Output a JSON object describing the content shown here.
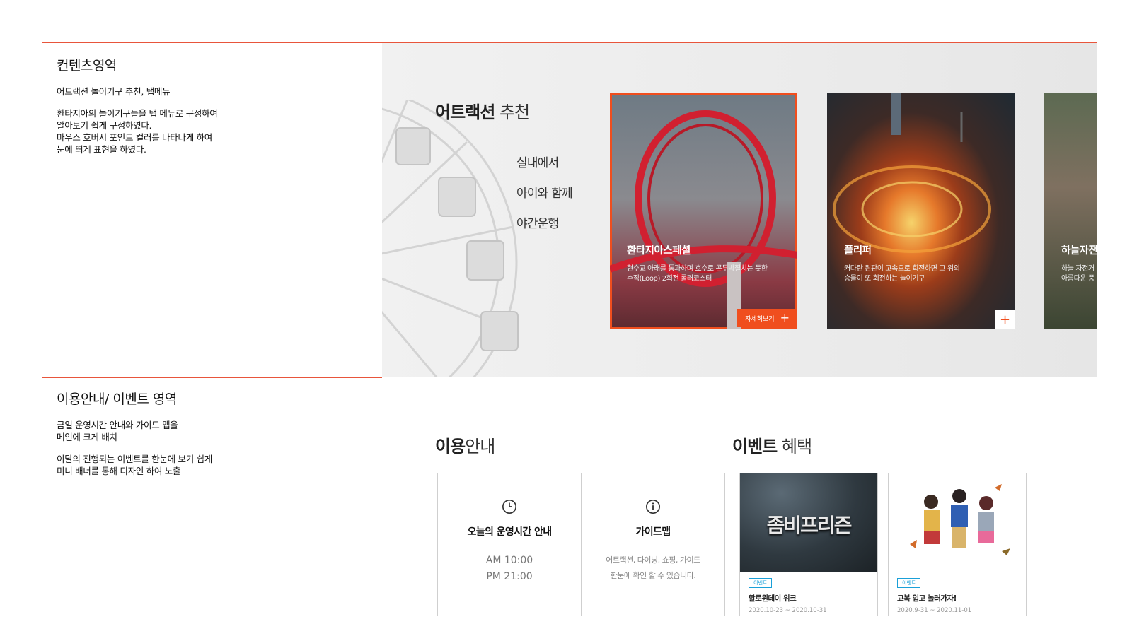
{
  "notes": {
    "content": {
      "title": "컨텐츠영역",
      "subtitle": "어트랙션 놀이기구 추천, 탭메뉴",
      "desc1": "환타지아의 놀이기구들을 탭 메뉴로 구성하여\n알아보기 쉽게 구성하였다.",
      "desc2": "마우스 호버시 포인트 컬러를 나타나게 하여\n눈에 띄게 표현을 하였다."
    },
    "info": {
      "title": "이용안내/ 이벤트 영역",
      "desc1": "금일 운영시간 안내와 가이드 맵을\n메인에 크게 배치",
      "desc2": "이달의 진행되는 이벤트를 한눈에 보기 쉽게\n미니 배너를 통해 디자인 하여 노출"
    }
  },
  "attraction": {
    "title_bold": "어트랙션",
    "title_light": " 추천",
    "tabs": [
      "실내에서",
      "아이와 함께",
      "야간운행"
    ],
    "cards": [
      {
        "name": "환타지아스페셜",
        "desc": "현수교 아래를 통과하며 호수로 곤두박칠치는 듯한\n수직(Loop) 2회전 롤러코스터",
        "more_label": "자세히보기",
        "more_icon": "+"
      },
      {
        "name": "플리퍼",
        "desc": "커다란 원판이 고속으로 회전하면 그 위의\n승물이 또 회전하는 놀이기구",
        "more_icon": "+"
      },
      {
        "name": "하늘자전거",
        "desc": "하늘 자전거\n아름다운 풍"
      }
    ]
  },
  "info": {
    "title_bold": "이용",
    "title_light": "안내",
    "hours_title": "오늘의 운영시간 안내",
    "open": "AM 10:00",
    "close": "PM 21:00",
    "guide_title": "가이드맵",
    "guide_desc1": "어트랙션, 다이닝, 쇼핑, 가이드",
    "guide_desc2": "한눈에 확인 할 수 있습니다."
  },
  "event": {
    "title_bold": "이벤트",
    "title_light": " 혜택",
    "items": [
      {
        "banner_text": "좀비프리즌",
        "badge": "이벤트",
        "title": "할로윈데이 위크",
        "date": "2020.10-23 ~ 2020.10-31"
      },
      {
        "badge": "이벤트",
        "title": "교복 입고 놀러가자!",
        "date": "2020.9-31 ~ 2020.11-01"
      }
    ]
  },
  "colors": {
    "accent": "#f04e1e",
    "rule": "#e8553b",
    "badge": "#1aa0d8"
  }
}
